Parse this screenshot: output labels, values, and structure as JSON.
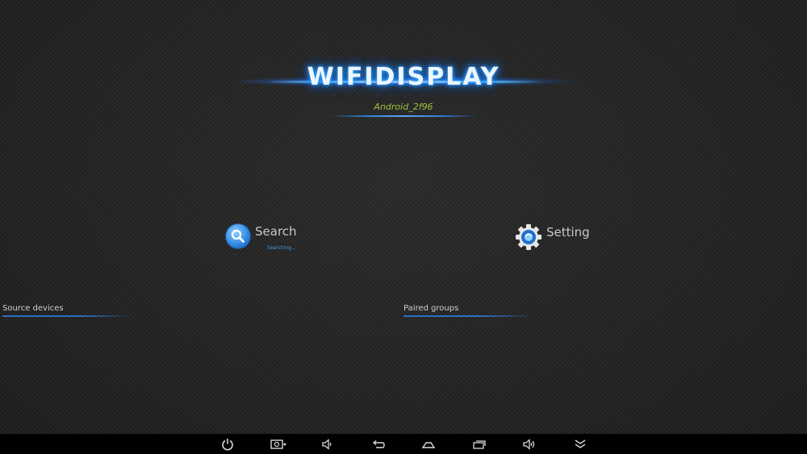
{
  "logo": {
    "title": "WIFIDISPLAY",
    "device_name": "Android_2f96"
  },
  "actions": {
    "search_label": "Search",
    "search_status": "Searching...",
    "setting_label": "Setting"
  },
  "sections": {
    "source_devices_label": "Source devices",
    "paired_groups_label": "Paired groups"
  },
  "navbar": {
    "buttons": [
      "power-icon",
      "screenshot-icon",
      "volume-down-icon",
      "back-icon",
      "home-icon",
      "recent-apps-icon",
      "volume-up-icon",
      "hide-bar-icon"
    ]
  },
  "colors": {
    "accent_blue": "#2e6fc0",
    "device_name_green": "#9fc23a",
    "background": "#242424"
  }
}
